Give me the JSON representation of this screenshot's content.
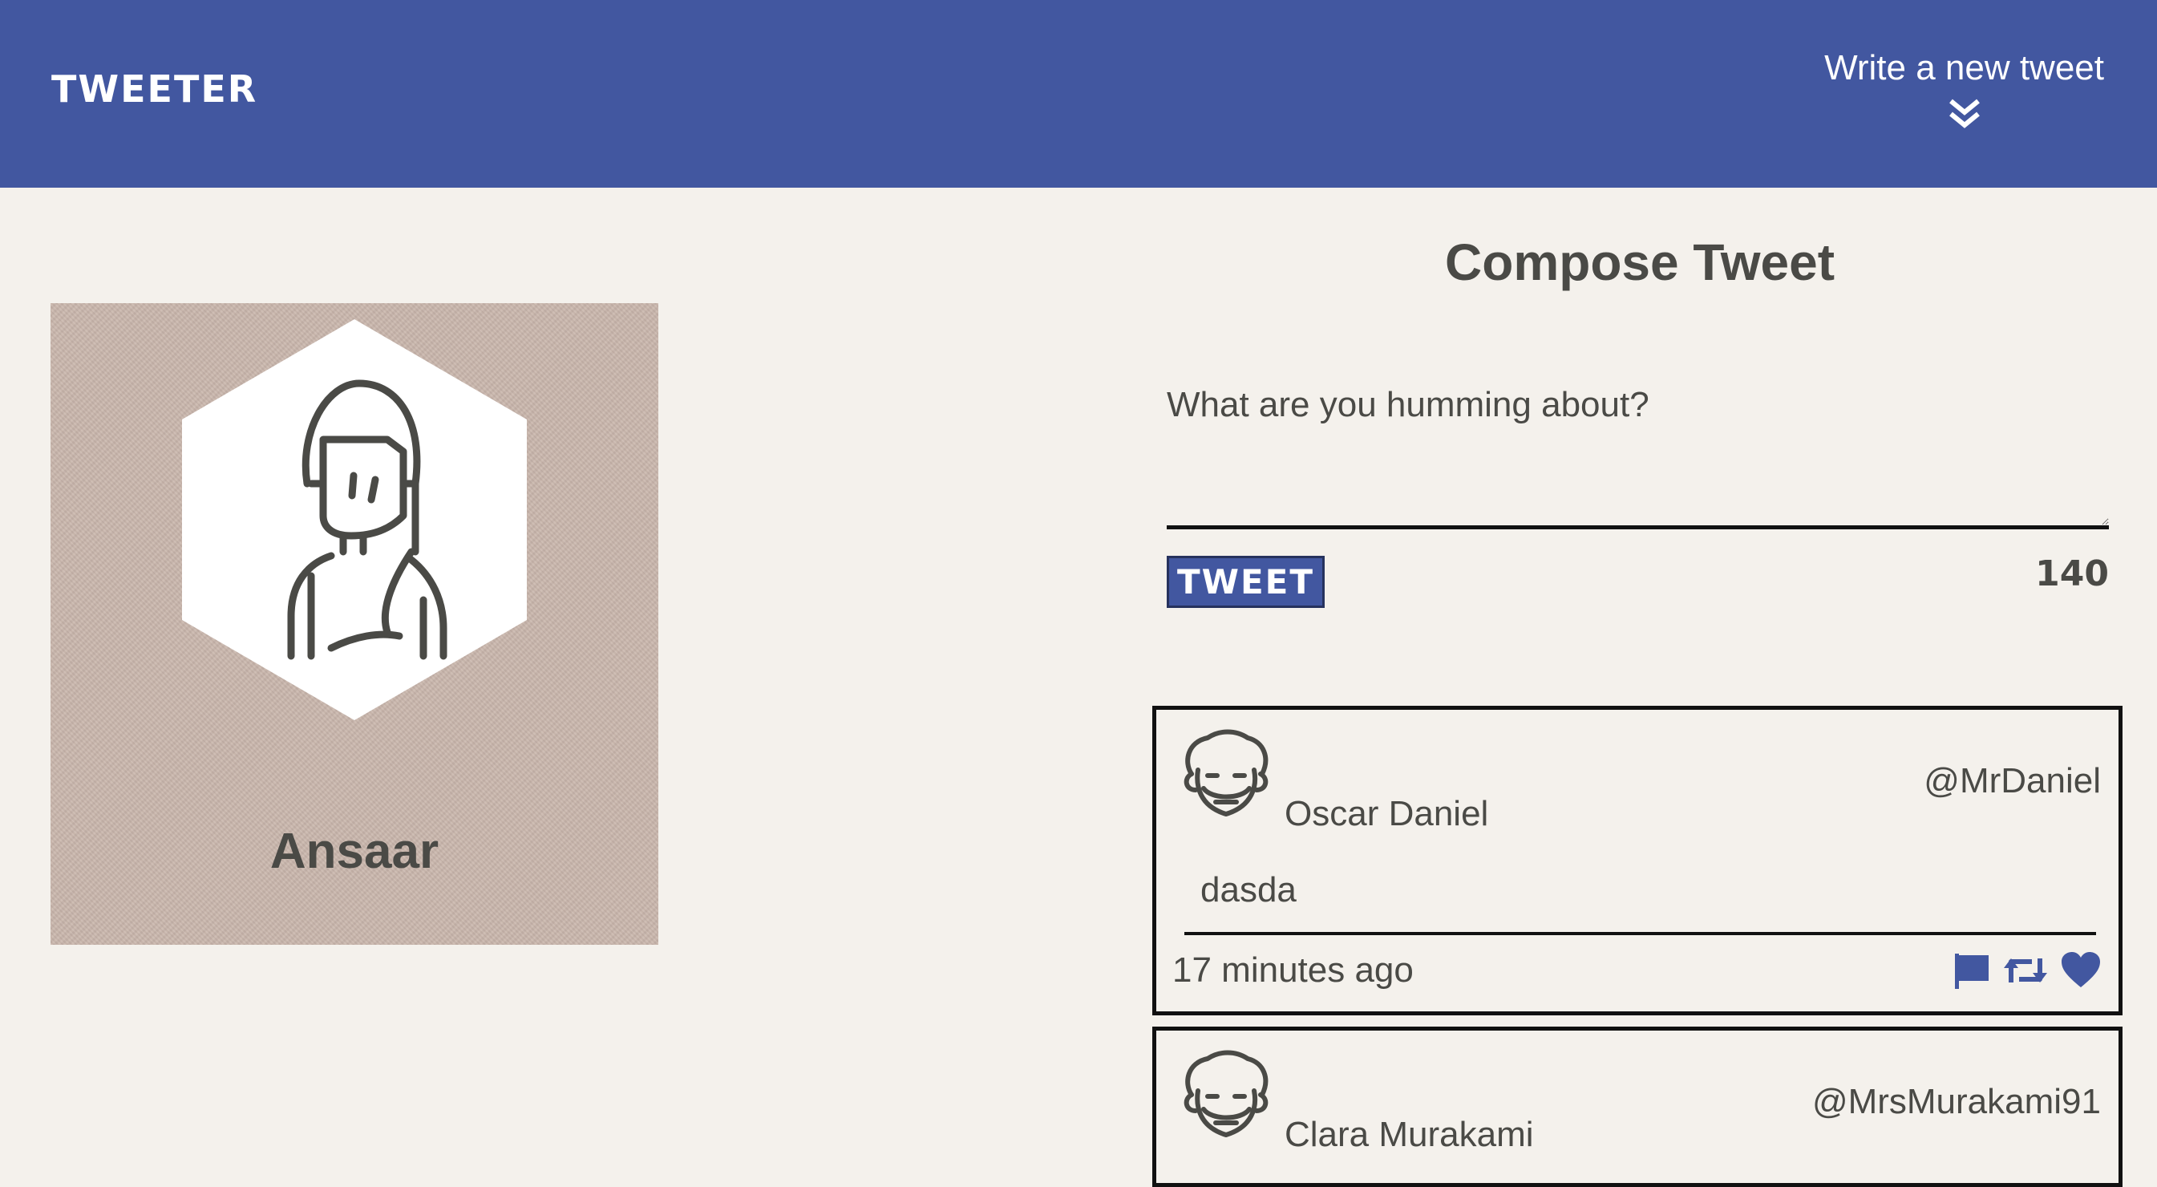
{
  "navbar": {
    "brand": "TWEETER",
    "compose_label": "Write a new tweet",
    "compose_icon": "double-chevron-down-icon"
  },
  "profile": {
    "name": "Ansaar",
    "avatar": "woman-avatar-icon",
    "background_color": "#c9b6ac"
  },
  "compose": {
    "title": "Compose Tweet",
    "placeholder": "What are you humming about?",
    "button_label": "TWEET",
    "counter": "140"
  },
  "tweets": [
    {
      "name": "Oscar Daniel",
      "handle": "@MrDaniel",
      "body": "dasda",
      "time": "17 minutes ago",
      "avatar": "curly-hair-man-icon",
      "actions": [
        "flag-icon",
        "retweet-icon",
        "heart-icon"
      ]
    },
    {
      "name": "Clara Murakami",
      "handle": "@MrsMurakami91",
      "avatar": "curly-hair-man-icon"
    }
  ],
  "colors": {
    "accent": "#4257a0",
    "background": "#f4f1ec",
    "text": "#4a4a46"
  }
}
